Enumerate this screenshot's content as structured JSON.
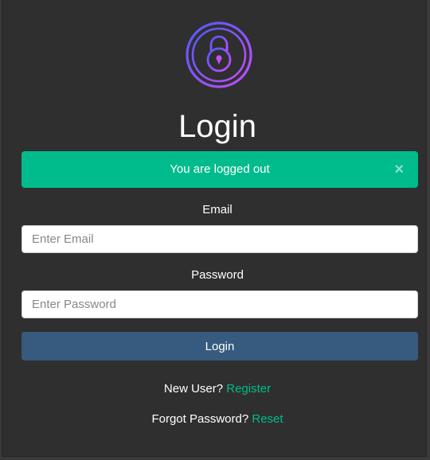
{
  "colors": {
    "card_bg": "#2f2f2f",
    "accent_green": "#00bc8c",
    "button_blue": "#375a7f",
    "logo_gradient_start": "#4f5bff",
    "logo_gradient_end": "#c44dff"
  },
  "logo": {
    "icon": "padlock-icon"
  },
  "page": {
    "title": "Login"
  },
  "alert": {
    "message": "You are logged out",
    "close_glyph": "×"
  },
  "form": {
    "email_label": "Email",
    "email_placeholder": "Enter Email",
    "email_value": "",
    "password_label": "Password",
    "password_placeholder": "Enter Password",
    "password_value": "",
    "submit_label": "Login"
  },
  "links": {
    "register_prefix": "New User?",
    "register_label": "Register",
    "reset_prefix": "Forgot Password?",
    "reset_label": "Reset"
  }
}
